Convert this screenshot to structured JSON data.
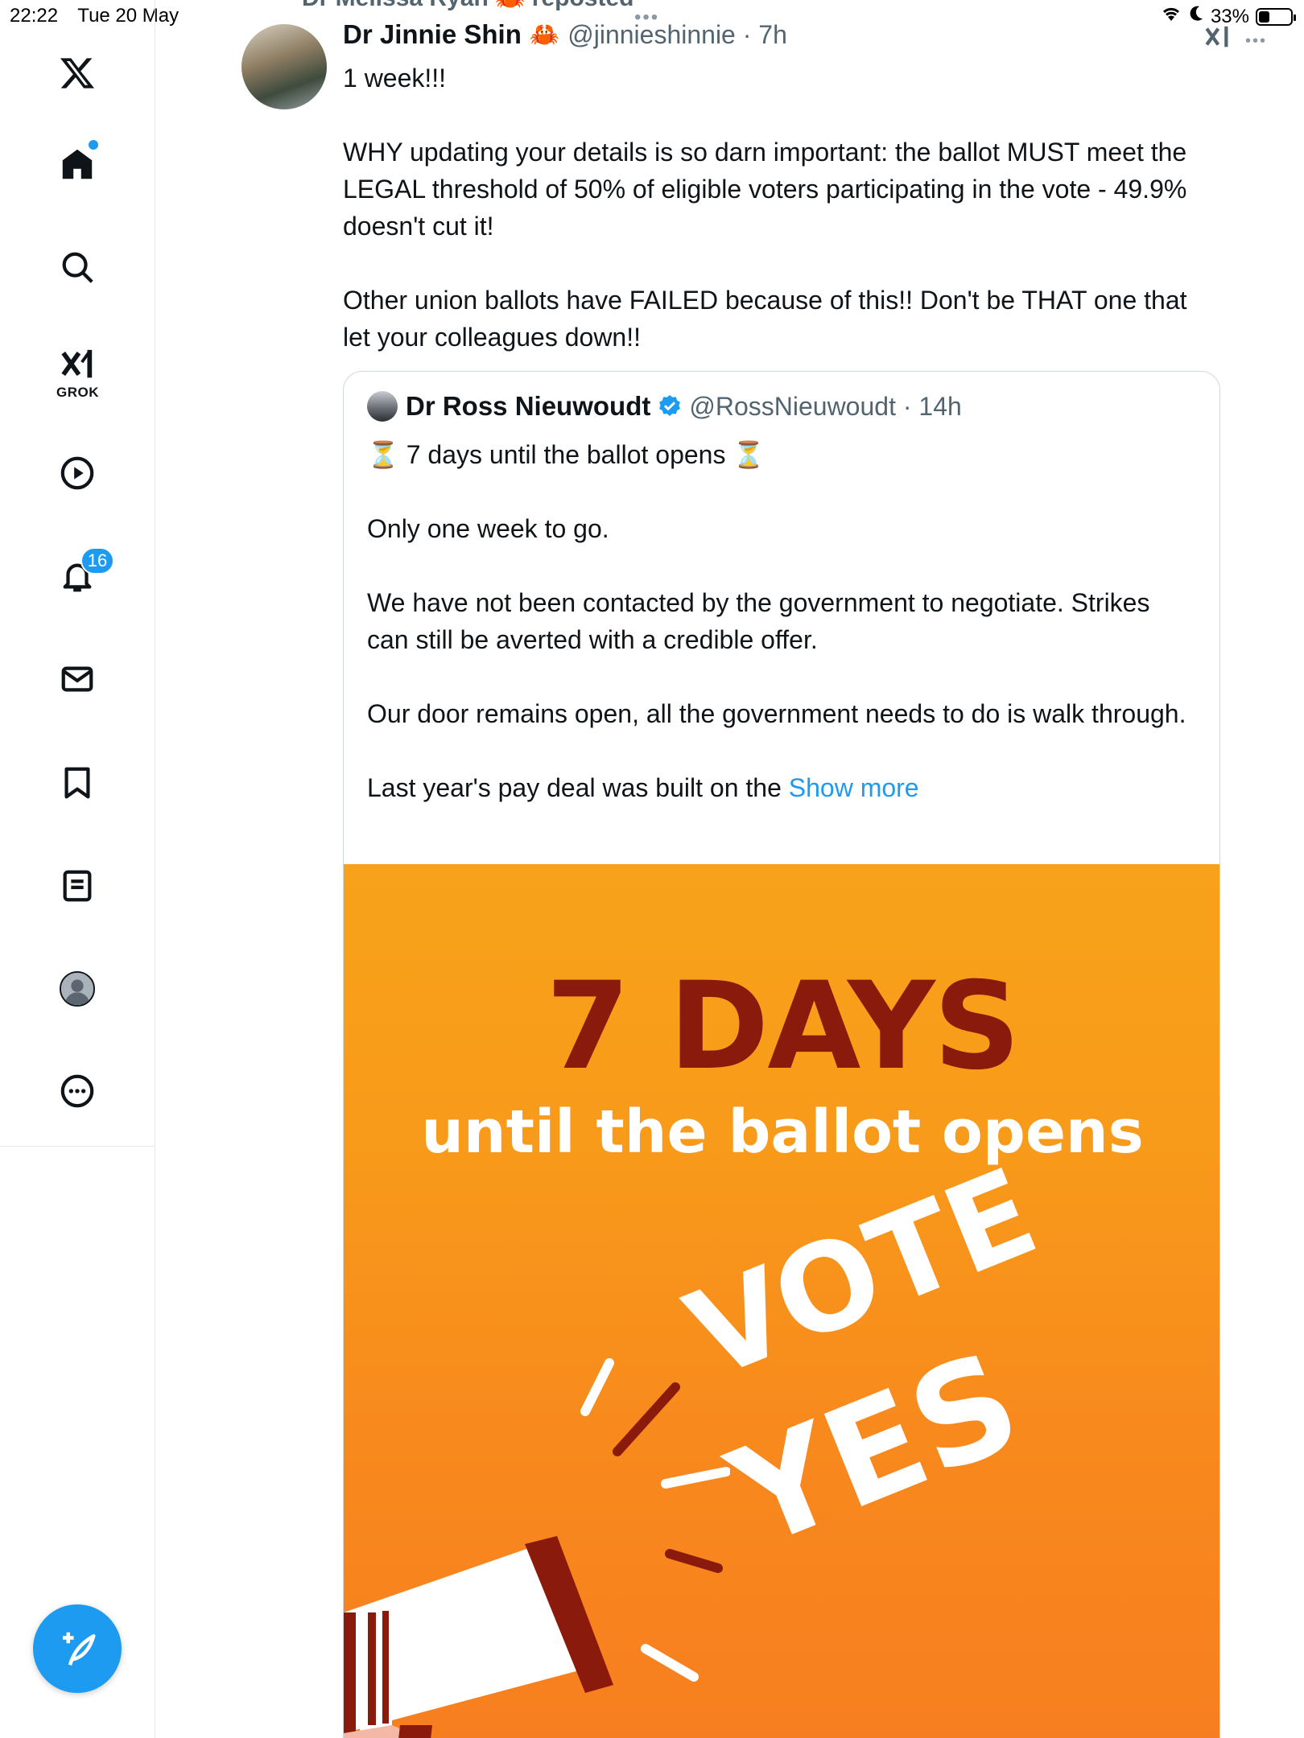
{
  "status_bar": {
    "time": "22:22",
    "date": "Tue 20 May",
    "battery": "33%",
    "battery_level": 0.33
  },
  "sidebar": {
    "grok_label": "GROK",
    "notifications_count": "16",
    "icons": [
      "x-logo-icon",
      "home-icon",
      "search-icon",
      "grok-icon",
      "video-icon",
      "notifications-icon",
      "messages-icon",
      "bookmarks-icon",
      "lists-icon",
      "profile-icon",
      "more-icon"
    ]
  },
  "post": {
    "reposted_by": "Dr Melissa Ryan 🦀 reposted",
    "author_name": "Dr Jinnie Shin",
    "author_emoji": "🦀",
    "handle_time": "@jinnieshinnie · 7h",
    "paragraphs": [
      "1 week!!!",
      "WHY updating your details is so darn important: the ballot MUST meet the LEGAL threshold of 50% of eligible voters participating in the vote - 49.9% doesn't cut it!",
      "Other union ballots have FAILED because of this!! Don't be THAT one that let your colleagues down!!"
    ]
  },
  "quote": {
    "author_name": "Dr Ross Nieuwoudt",
    "handle_time": "@RossNieuwoudt · 14h",
    "paragraphs": [
      "⏳ 7 days until the ballot opens ⏳",
      "Only one week to go.",
      "We have not been contacted by the government to negotiate. Strikes can still be averted with a credible offer.",
      "Our door remains open, all the government needs to do is walk through."
    ],
    "last_line": "Last year's pay deal was built on the ",
    "show_more": "Show more"
  },
  "poster": {
    "headline": "7 DAYS",
    "subline": "until the ballot opens",
    "vote": "VOTE",
    "yes": "YES"
  },
  "colors": {
    "accent": "#1d9bf0",
    "poster_orange": "#f89a1a",
    "poster_dark_red": "#8a1a0c"
  }
}
